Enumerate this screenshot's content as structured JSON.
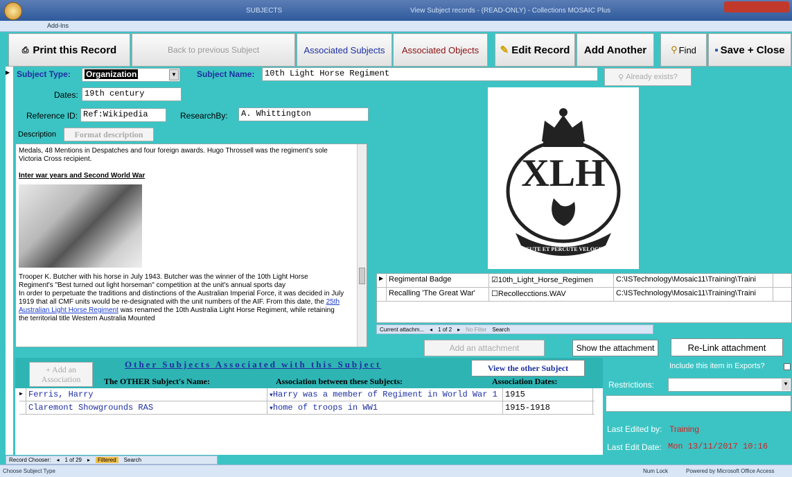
{
  "window": {
    "title": "SUBJECTS",
    "subtitle": "View Subject records - (READ-ONLY) - Collections MOSAIC Plus",
    "ribbon": "Add-Ins"
  },
  "toolbar": {
    "print": "Print this Record",
    "back": "Back to previous Subject",
    "assoc_subjects": "Associated Subjects",
    "assoc_objects": "Associated Objects",
    "edit": "Edit Record",
    "add": "Add Another",
    "find": "Find",
    "save": "Save + Close"
  },
  "form": {
    "subject_type_label": "Subject Type:",
    "subject_type_value": "Organization",
    "subject_name_label": "Subject Name:",
    "subject_name_value": "10th Light Horse Regiment",
    "already_exists": "Already exists?",
    "dates_label": "Dates:",
    "dates_value": "19th century",
    "ref_label": "Reference ID:",
    "ref_value": "Ref:Wikipedia",
    "research_label": "ResearchBy:",
    "research_value": "A. Whittington",
    "desc_label": "Description",
    "format_desc": "Format description"
  },
  "description": {
    "p1": "Medals, 48 Mentions in Despatches and four foreign awards. Hugo Throssell was the regiment's sole Victoria Cross recipient.",
    "heading": "Inter war years and Second World War",
    "caption": "Trooper K. Butcher with his horse in July 1943. Butcher was the winner of the 10th Light Horse Regiment's \"Best turned out light horseman\" competition at the unit's annual sports day",
    "p2a": "In order to perpetuate the traditions and distinctions of the Australian Imperial Force, it was decided in July 1919 that all CMF units would be re-designated with the unit numbers of the AIF. From this date, the ",
    "p2link": "25th Australian Light Horse Regiment",
    "p2b": " was renamed the 10th Australia Light Horse Regiment, while retaining the territorial title Western Australia Mounted"
  },
  "attachments": {
    "rows": [
      {
        "name": "Regimental Badge",
        "file": "10th_Light_Horse_Regimen",
        "path": "C:\\ISTechnology\\Mosaic11\\Training\\Traini"
      },
      {
        "name": "Recalling 'The Great War'",
        "file": "Recollecctions.WAV",
        "path": "C:\\ISTechnology\\Mosaic11\\Training\\Traini"
      }
    ],
    "nav_label": "Current attachm...",
    "nav_pos": "1 of 2",
    "nofilter": "No Filter",
    "search": "Search",
    "add_btn": "Add an attachment",
    "show_btn": "Show the attachment",
    "relink_btn": "Re-Link attachment"
  },
  "assoc": {
    "title": "Other Subjects Associated with this Subject",
    "add_btn": "+ Add an Association",
    "view_btn": "View the other Subject",
    "col1": "The OTHER Subject's Name:",
    "col2": "Association between these Subjects:",
    "col3": "Association Dates:",
    "rows": [
      {
        "name": "Ferris, Harry",
        "assoc": "Harry was a member of Regiment in World War 1",
        "dates": "1915"
      },
      {
        "name": "Claremont Showgrounds RAS",
        "assoc": "home of troops in WW1",
        "dates": "1915-1918"
      }
    ]
  },
  "side": {
    "include": "Include this item in Exports?",
    "restrictions": "Restrictions:",
    "edited_by_label": "Last Edited by:",
    "edited_by": "Training",
    "edit_date_label": "Last Edit Date:",
    "edit_date": "Mon 13/11/2017 10:16"
  },
  "record_nav": {
    "label": "Record Chooser:",
    "pos": "1 of 29",
    "filtered": "Filtered",
    "search": "Search"
  },
  "status": {
    "left": "Choose Subject Type",
    "numlock": "Num Lock",
    "powered": "Powered by Microsoft Office Access"
  },
  "badge": {
    "letters": "XLH",
    "motto": "PERCUTE ET PERCUTE VELOCITER"
  }
}
